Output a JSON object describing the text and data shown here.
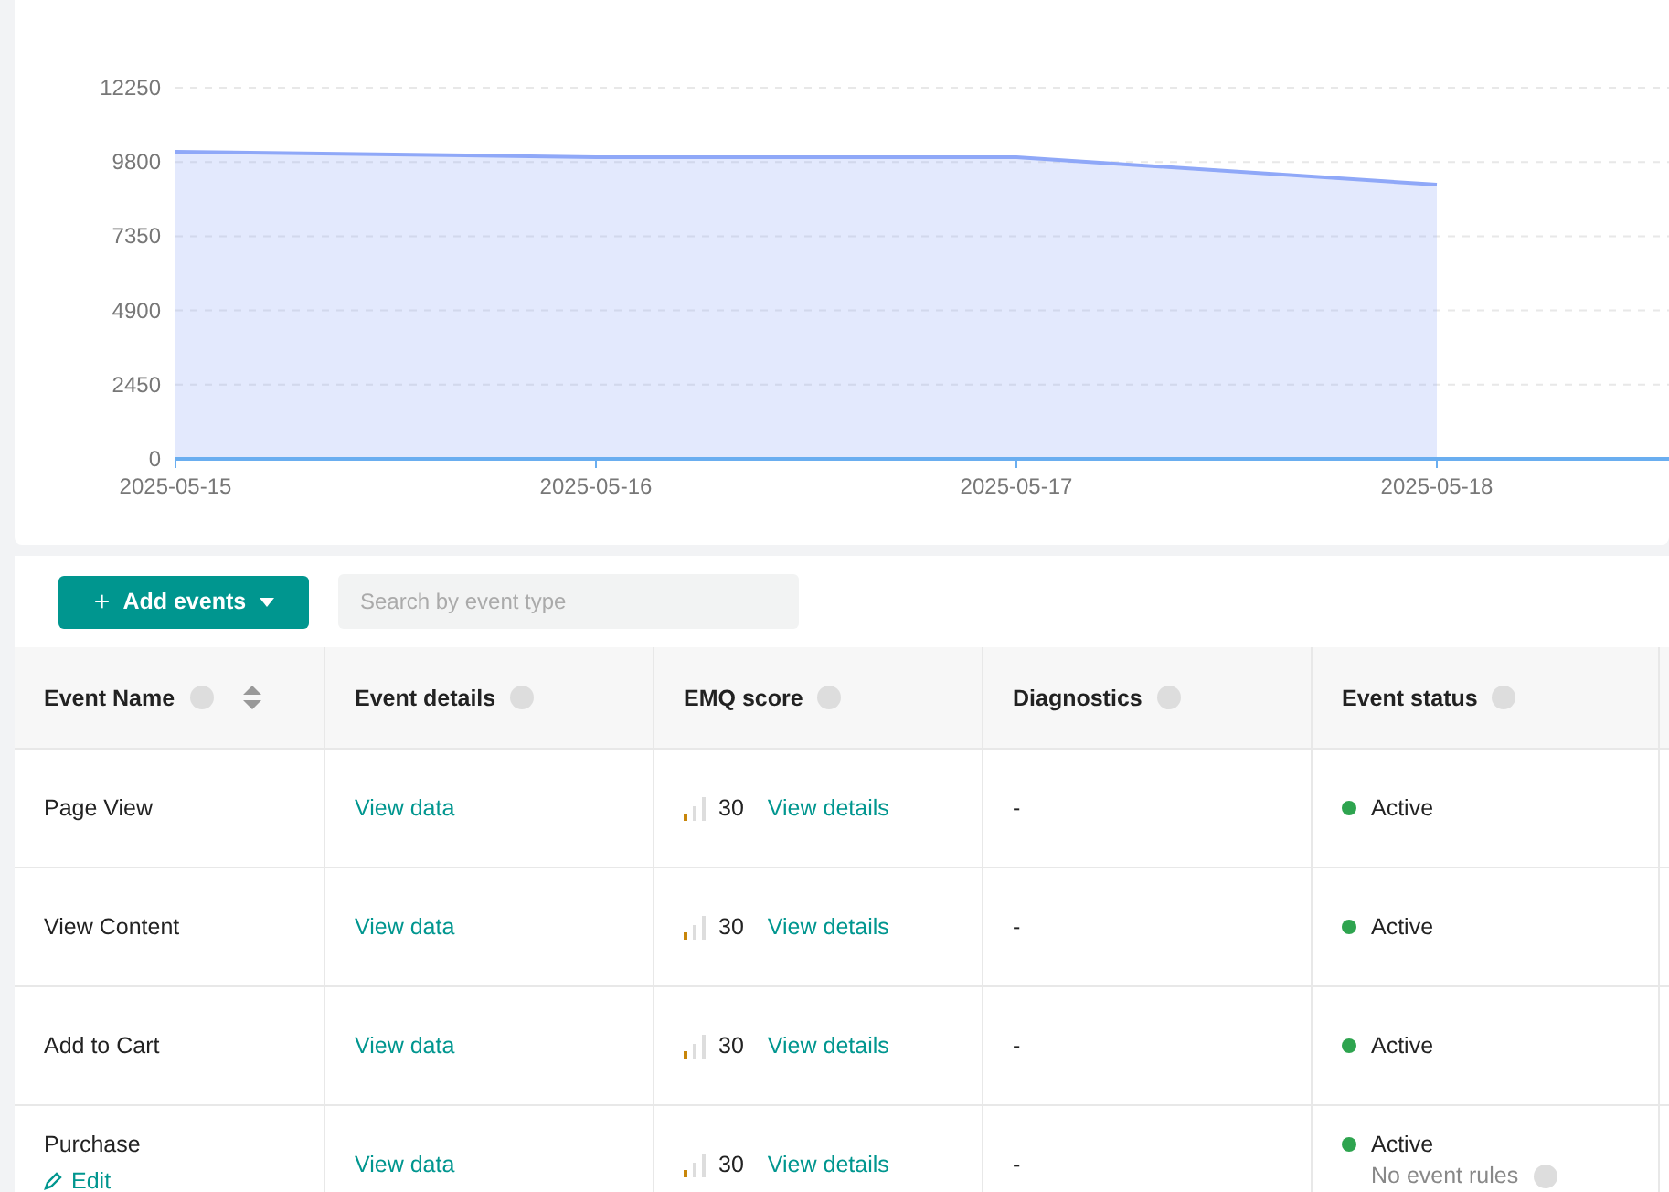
{
  "chart": {
    "chart_data": {
      "type": "area",
      "categories": [
        "2025-05-15",
        "2025-05-16",
        "2025-05-17",
        "2025-05-18"
      ],
      "series": [
        {
          "color": "#8fa8f8",
          "values": [
            10140,
            9960,
            9960,
            9050
          ]
        }
      ],
      "ylim": [
        0,
        12250
      ],
      "grid": true,
      "yticks": [
        0,
        2450,
        4900,
        7350,
        9800,
        12250
      ]
    }
  },
  "toolbar": {
    "add_icon": "+",
    "add_button": "Add events",
    "search": {
      "placeholder": "Search by event type"
    }
  },
  "table": {
    "columns": [
      {
        "label": "Event Name",
        "sortable": true
      },
      {
        "label": "Event details",
        "sortable": false
      },
      {
        "label": "EMQ score",
        "sortable": false
      },
      {
        "label": "Diagnostics",
        "sortable": false
      },
      {
        "label": "Event status",
        "sortable": false
      }
    ],
    "rows": [
      {
        "name": "Page View",
        "details": "View data",
        "score": "30",
        "score_link": "View details",
        "diagnostics": "-",
        "status": "Active",
        "color": "#2ea44f"
      },
      {
        "name": "View Content",
        "details": "View data",
        "score": "30",
        "score_link": "View details",
        "diagnostics": "-",
        "status": "Active",
        "color": "#2ea44f"
      },
      {
        "name": "Add to Cart",
        "details": "View data",
        "score": "30",
        "score_link": "View details",
        "diagnostics": "-",
        "status": "Active",
        "color": "#2ea44f"
      },
      {
        "name": "Purchase",
        "edit": "Edit",
        "details": "View data",
        "score": "30",
        "score_link": "View details",
        "diagnostics": "-",
        "status": "Active",
        "color": "#2ea44f",
        "status_note": "No event rules"
      }
    ]
  }
}
